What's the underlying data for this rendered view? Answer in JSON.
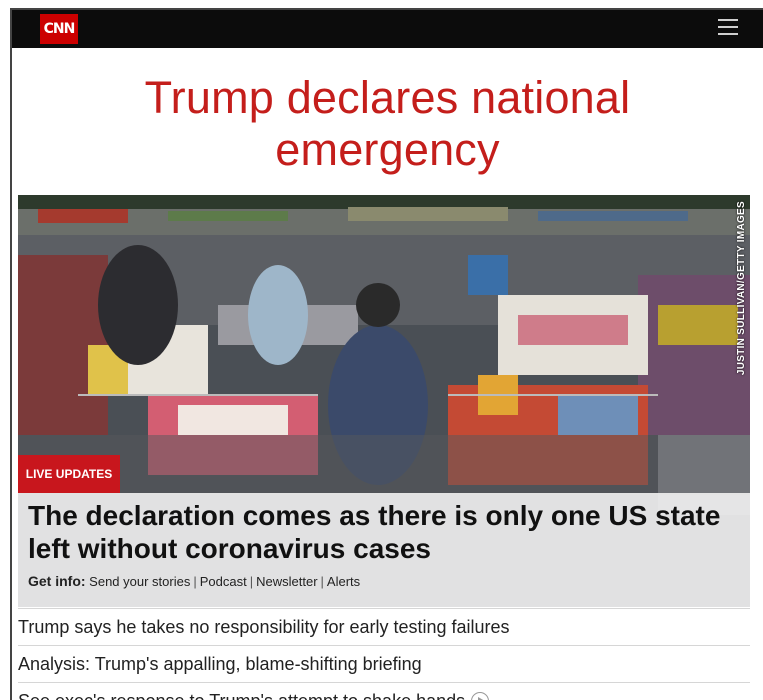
{
  "header": {
    "logo_text": "CNN",
    "menu_icon": "hamburger-menu-icon"
  },
  "headline": {
    "line1": "Trump declares national",
    "line2": "emergency",
    "color": "#c41e1b"
  },
  "hero": {
    "photo_credit": "JUSTIN SULLIVAN/GETTY IMAGES",
    "badge": "LIVE UPDATES",
    "title": "The declaration comes as there is only one US state left without coronavirus cases",
    "get_info_label": "Get info:",
    "links": [
      "Send your stories",
      "Podcast",
      "Newsletter",
      "Alerts"
    ]
  },
  "stories": [
    "Trump says he takes no responsibility for early testing failures",
    "Analysis: Trump's appalling, blame-shifting briefing",
    "See exec's response to Trump's attempt to shake hands"
  ],
  "colors": {
    "brand_red": "#cc0000",
    "badge_red": "#c8161d",
    "topbar": "#0c0c0c"
  }
}
